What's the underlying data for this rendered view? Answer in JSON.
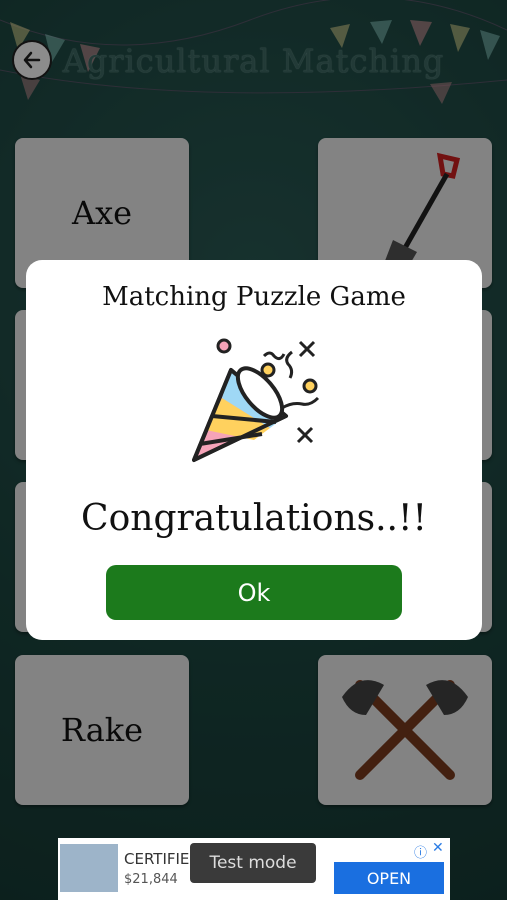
{
  "header": {
    "title": "Agricultural Matching",
    "back_icon": "arrow-left-icon"
  },
  "cards": {
    "card_axe_label": "Axe",
    "card_rake_label": "Rake",
    "card_shovel_icon": "shovel-icon",
    "card_crossed_axes_icon": "crossed-axes-icon"
  },
  "dialog": {
    "title": "Matching Puzzle Game",
    "icon": "party-popper-icon",
    "message": "Congratulations..!!",
    "ok_label": "Ok"
  },
  "ad": {
    "title": "CERTIFIE",
    "price": "$21,844",
    "open_label": "OPEN",
    "test_mode_label": "Test mode",
    "info_icon": "info-icon",
    "close_icon": "close-icon"
  },
  "colors": {
    "background": "#1f4a45",
    "ok_button": "#1c7a1c",
    "ad_open_button": "#1a6fe0"
  }
}
